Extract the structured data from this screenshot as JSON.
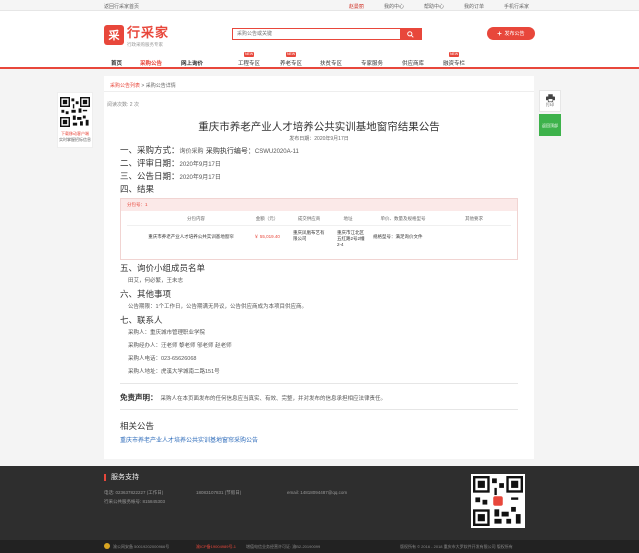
{
  "topbar": {
    "back_link": "返回行采家首页",
    "region": "赵曼丽",
    "links": [
      "我的中心",
      "帮助中心",
      "我的订单",
      "手机行采家"
    ]
  },
  "header": {
    "logo_mark": "采",
    "logo_name": "行采家",
    "logo_slogan": "行政采购服务专家",
    "search_placeholder": "采购公告或关键",
    "publish_label": "发布公告"
  },
  "nav": {
    "items": [
      {
        "label": "首页",
        "hot": ""
      },
      {
        "label": "采购公告",
        "hot": ""
      },
      {
        "label": "网上询价",
        "hot": ""
      },
      {
        "label": "工程专区",
        "hot": "NEW"
      },
      {
        "label": "养老专区",
        "hot": "NEW"
      },
      {
        "label": "扶贫专区",
        "hot": ""
      },
      {
        "label": "专家服务",
        "hot": ""
      },
      {
        "label": "供应商库",
        "hot": ""
      },
      {
        "label": "融资专栏",
        "hot": "NEW"
      }
    ]
  },
  "breadcrumb": {
    "first": "采购公告列表",
    "sep": ">",
    "second": "采购公告详情"
  },
  "views": "阅读次数: 2 次",
  "notice": {
    "title": "重庆市养老产业人才培养公共实训基地窗帘结果公告",
    "pubdate": "发布日期：2020年9月17日",
    "s1_label": "一、采购方式：",
    "s1_method": "询价采购",
    "s1_code_label": "采购执行编号：",
    "s1_code": "CSWU2020A-11",
    "s2_label": "二、评审日期：",
    "s2_value": "2020年9月17日",
    "s3_label": "三、公告日期：",
    "s3_value": "2020年9月17日",
    "s4_label": "四、结果"
  },
  "result": {
    "package": "分包号：1",
    "headers": [
      "分包内容",
      "金额（元）",
      "成交供应商",
      "地址",
      "单价、数量及规格型号",
      "其他要求"
    ],
    "row": {
      "content": "重庆市养老产业人才培养公共实训基地窗帘",
      "amount": "￥ 55,019.40",
      "supplier": "重庆凤凰布艺有限公司",
      "address": "重庆市江北区五红路2号2幢2-4",
      "spec": "规格型号：满足询价文件",
      "other": ""
    }
  },
  "section5": {
    "label": "五、询价小组成员名单",
    "members": "田艾，何必繁，王未志"
  },
  "section6": {
    "label": "六、其他事项",
    "text": "公告期限：1个工作日，公告期满无异议，公告供应商成为本项目供应商。"
  },
  "section7": {
    "label": "七、联系人",
    "buyer": "采购人：重庆城市管理职业学院",
    "handlers": "采购经办人：汪老师 黎老师 邬老师 赵老师",
    "phone": "采购人电话：023-65626068",
    "address": "采购人地址：虎溪大学城南二路151号"
  },
  "disclaimer": {
    "label": "免责声明：",
    "text": "采购人在本页面发布的任何信息应当真实、有效、完整，并对发布的信息承担相应法律责任。"
  },
  "related": {
    "title": "相关公告",
    "link": "重庆市养老产业人才培养公共实训基地窗帘采购公告"
  },
  "side_qr": {
    "cap1": "下载移动客户端",
    "cap2": "实时掌握招标信息"
  },
  "right_float": {
    "print": "打印",
    "backtop": "返回顶部"
  },
  "footer": {
    "title": "服务支持",
    "phone1": "电话: 023637822227 (工作日)",
    "phone2": "18083107831 (节假日)",
    "email": "email: 14818094487@qq.com",
    "wechat": "行采公共服务帐号: 815845303"
  },
  "bottombar": {
    "icp": "渝公网安备 50019202000966号",
    "icp2": "渝ICP备19004989号-1",
    "license": "增值电信业务经营许可证: 渝B2-20190099",
    "copyright": "版权所有 © 2016 - 2018 重庆市大罗软件开发有限公司 版权所有"
  },
  "colors": {
    "brand": "#e8473b",
    "link": "#2f6dbb",
    "footer_bg": "#2e2e2e"
  }
}
